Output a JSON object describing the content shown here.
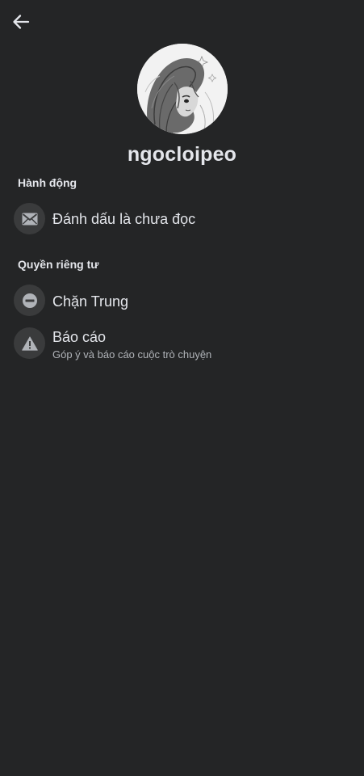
{
  "header": {
    "back_icon": "arrow-left-icon"
  },
  "profile": {
    "name": "ngocloipeo",
    "avatar_icon": "manga-girl-avatar"
  },
  "sections": {
    "actions": {
      "title": "Hành động",
      "items": [
        {
          "label": "Đánh dấu là chưa đọc",
          "icon": "envelope-icon"
        }
      ]
    },
    "privacy": {
      "title": "Quyền riêng tư",
      "items": [
        {
          "label": "Chặn Trung",
          "icon": "block-icon"
        },
        {
          "label": "Báo cáo",
          "sublabel": "Góp ý và báo cáo cuộc trò chuyện",
          "icon": "warning-icon"
        }
      ]
    }
  },
  "colors": {
    "background": "#242526",
    "text_primary": "#e4e6eb",
    "text_secondary": "#b0b3b8",
    "icon_circle": "#3a3b3c",
    "icon_glyph": "#b0b3b8"
  }
}
